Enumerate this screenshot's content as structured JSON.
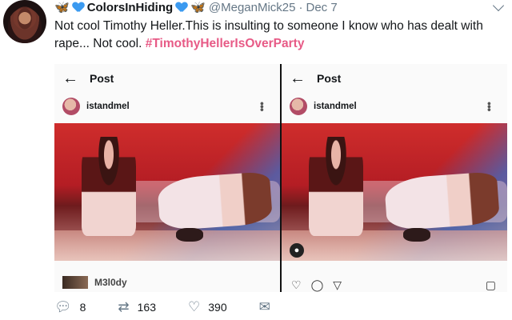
{
  "tweet": {
    "display_name": "ColorsInHiding",
    "handle": "@MeganMick25",
    "separator": "·",
    "date": "Dec 7",
    "text": "Not cool Timothy Heller.This is insulting to someone I know who has dealt with rape... Not cool. ",
    "hashtag": "#TimothyHellerIsOverParty"
  },
  "screenshots": {
    "left": {
      "title": "Post",
      "username": "istandmel",
      "commenter": "M3l0dy"
    },
    "right": {
      "title": "Post",
      "username": "istandmel"
    }
  },
  "footer": {
    "replies": "8",
    "retweets": "163",
    "likes": "390"
  },
  "icons": {
    "reply": "reply-icon",
    "retweet": "retweet-icon",
    "like": "heart-icon",
    "dm": "envelope-icon",
    "back": "back-arrow-icon",
    "more": "more-dots-icon"
  },
  "colors": {
    "hashtag": "#e0245e",
    "muted": "#657786",
    "accent": "#1da1f2"
  }
}
